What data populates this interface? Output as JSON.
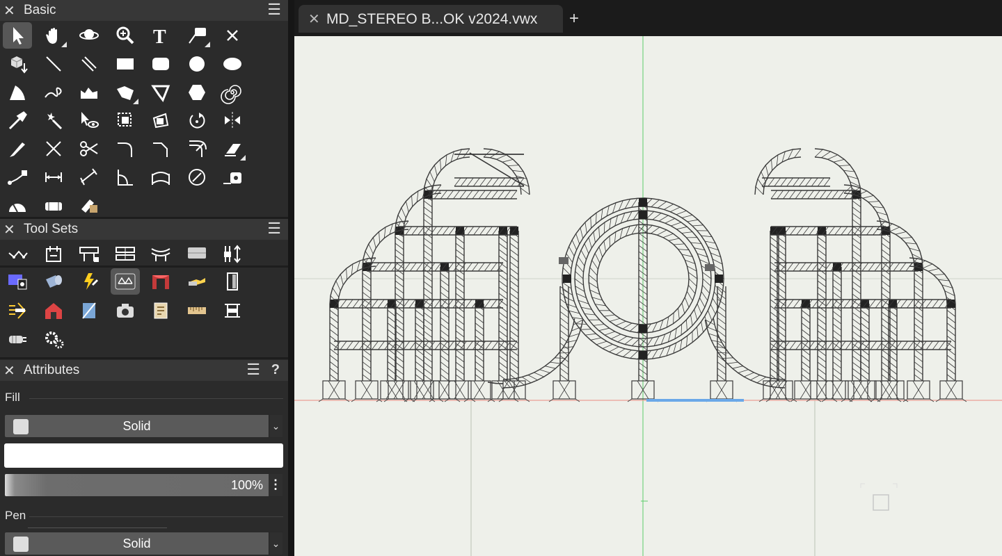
{
  "panels": {
    "basic": {
      "title": "Basic"
    },
    "toolsets": {
      "title": "Tool Sets"
    },
    "attributes": {
      "title": "Attributes",
      "help": "?"
    }
  },
  "attributes": {
    "fill_label": "Fill",
    "fill_style": "Solid",
    "opacity": "100%",
    "pen_label": "Pen",
    "pen_style": "Solid",
    "fill_color": "#ffffff"
  },
  "document": {
    "tab_title": "MD_STEREO B...OK v2024.vwx",
    "new_tab": "+"
  },
  "basic_tools": [
    {
      "name": "selection-tool",
      "icon": "arrow-icon",
      "text": ""
    },
    {
      "name": "pan-tool",
      "icon": "hand-icon",
      "text": ""
    },
    {
      "name": "flyover-tool",
      "icon": "flyover-icon",
      "text": ""
    },
    {
      "name": "zoom-tool",
      "icon": "magnifier-icon",
      "text": ""
    },
    {
      "name": "text-tool",
      "icon": "text-icon",
      "text": "T"
    },
    {
      "name": "callout-tool",
      "icon": "callout-icon",
      "text": ""
    },
    {
      "name": "locus-tool",
      "icon": "locus-icon",
      "text": "✕"
    }
  ],
  "colors": {
    "accent_selection": "#575757",
    "canvas": "#eef0ea",
    "truss": "#333333",
    "guide_green": "#5ccd6a",
    "guide_red": "#e98a80",
    "highlight_blue": "#6aa8e8"
  }
}
